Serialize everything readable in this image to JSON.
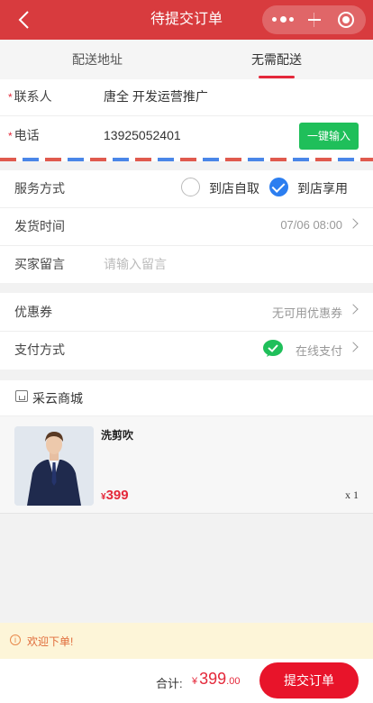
{
  "header": {
    "title": "待提交订单",
    "accent": "#d83b3e"
  },
  "tabs": [
    {
      "label": "配送地址",
      "active": false
    },
    {
      "label": "无需配送",
      "active": true
    }
  ],
  "contact": {
    "name_label": "联系人",
    "name_value": "唐全 开发运营推广",
    "phone_label": "电话",
    "phone_value": "13925052401",
    "required_mark": "*",
    "autofill_button": "一键输入"
  },
  "service": {
    "label": "服务方式",
    "options": [
      {
        "label": "到店自取",
        "selected": false
      },
      {
        "label": "到店享用",
        "selected": true
      }
    ]
  },
  "delivery_time": {
    "label": "发货时间",
    "value": "07/06 08:00"
  },
  "remark": {
    "label": "买家留言",
    "placeholder": "请输入留言"
  },
  "coupon": {
    "label": "优惠券",
    "value": "无可用优惠券"
  },
  "payment": {
    "label": "支付方式",
    "value": "在线支付",
    "icon": "wechat-pay-icon"
  },
  "shop": {
    "icon": "shop-icon",
    "name": "采云商城"
  },
  "product": {
    "name": "洗剪吹",
    "price_symbol": "¥",
    "price": "399",
    "quantity": "x 1"
  },
  "notice": {
    "icon": "info-icon",
    "text": "欢迎下单!"
  },
  "footer": {
    "total_label": "合计:",
    "currency": "¥",
    "total_integer": "399",
    "total_cents": ".00",
    "submit_label": "提交订单",
    "submit_color": "#e8142a"
  }
}
